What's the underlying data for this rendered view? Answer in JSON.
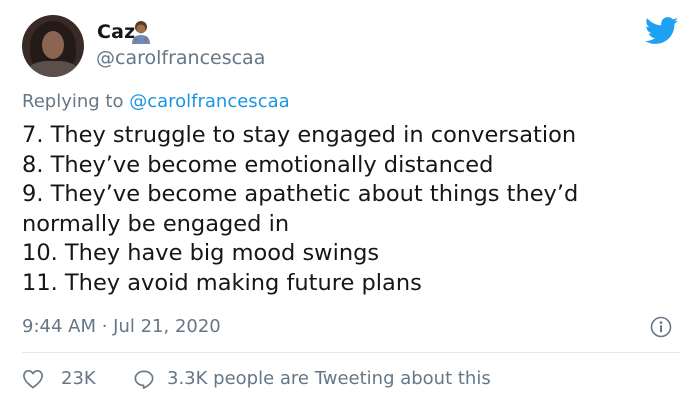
{
  "author": {
    "name": "Caz",
    "handle": "@carolfrancescaa"
  },
  "reply": {
    "prefix": "Replying to",
    "handle": "@carolfrancescaa"
  },
  "body_lines": [
    "7. They struggle to stay engaged in conversation",
    "8. They’ve become emotionally distanced",
    "9. They’ve become apathetic about things they’d",
    "normally be engaged in",
    "10. They have big mood swings",
    "11. They avoid making future plans"
  ],
  "timestamp": "9:44 AM · Jul 21, 2020",
  "actions": {
    "likes": "23K",
    "conversation": "3.3K people are Tweeting about this"
  },
  "colors": {
    "twitter_blue": "#1da1f2",
    "link_blue": "#1b95e0",
    "muted_text": "#657786",
    "divider": "#e1e8ed"
  },
  "icons": [
    "avatar",
    "person-emoji-icon",
    "twitter-bird-icon",
    "info-icon",
    "heart-icon",
    "comment-bubble-icon"
  ]
}
